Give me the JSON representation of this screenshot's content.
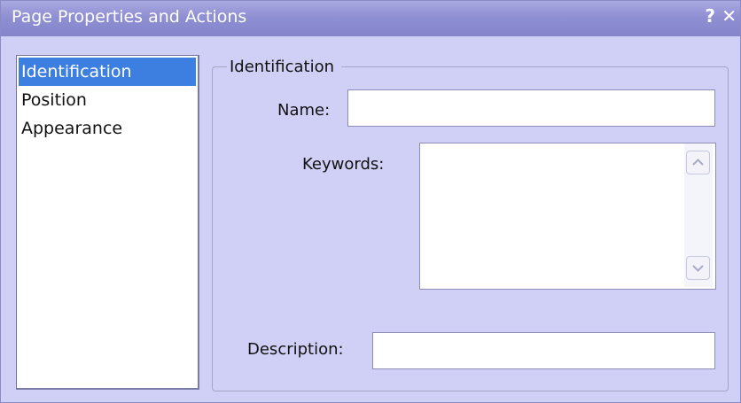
{
  "window": {
    "title": "Page  Properties and Actions",
    "help_label": "?",
    "close_label": "✕"
  },
  "nav": {
    "items": [
      {
        "label": "Identification",
        "selected": true
      },
      {
        "label": "Position",
        "selected": false
      },
      {
        "label": "Appearance",
        "selected": false
      }
    ]
  },
  "group": {
    "legend": "Identification"
  },
  "form": {
    "name_label": "Name:",
    "name_value": "",
    "keywords_label": "Keywords:",
    "keywords_value": "",
    "description_label": "Description:",
    "description_value": ""
  },
  "icons": {
    "help": "help-icon",
    "close": "close-icon",
    "scroll_up": "chevron-up-icon",
    "scroll_down": "chevron-down-icon"
  },
  "colors": {
    "titlebar": "#8f8fd3",
    "dialog_background": "#d0d0f6",
    "selection": "#3d7fe0"
  }
}
